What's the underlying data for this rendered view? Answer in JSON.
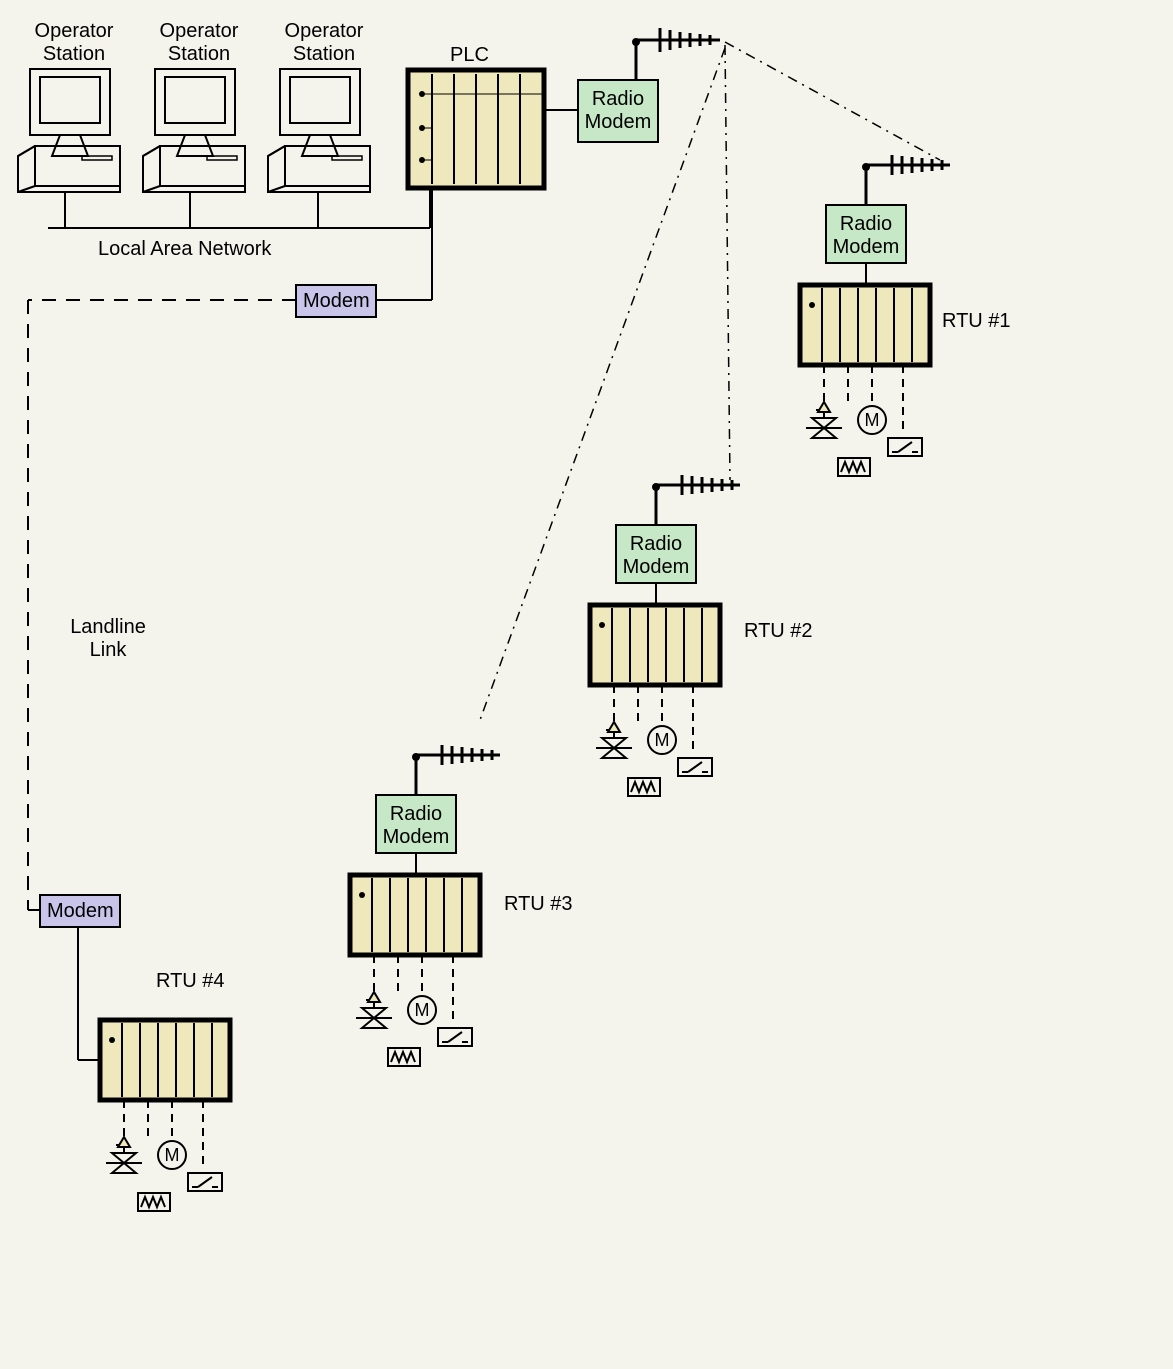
{
  "labels": {
    "operator1": "Operator\nStation",
    "operator2": "Operator\nStation",
    "operator3": "Operator\nStation",
    "plc": "PLC",
    "lan": "Local Area Network",
    "landline": "Landline\nLink",
    "modem1": "Modem",
    "modem2": "Modem",
    "radio_modem": "Radio\nModem",
    "rtu1": "RTU #1",
    "rtu2": "RTU #2",
    "rtu3": "RTU #3",
    "rtu4": "RTU #4",
    "motor_letter": "M"
  },
  "colors": {
    "bg": "#f4f4ec",
    "rack_fill": "#efe8bc",
    "radio_fill": "#c6e8c6",
    "modem_fill": "#c9c4ea",
    "stroke": "#000000"
  }
}
